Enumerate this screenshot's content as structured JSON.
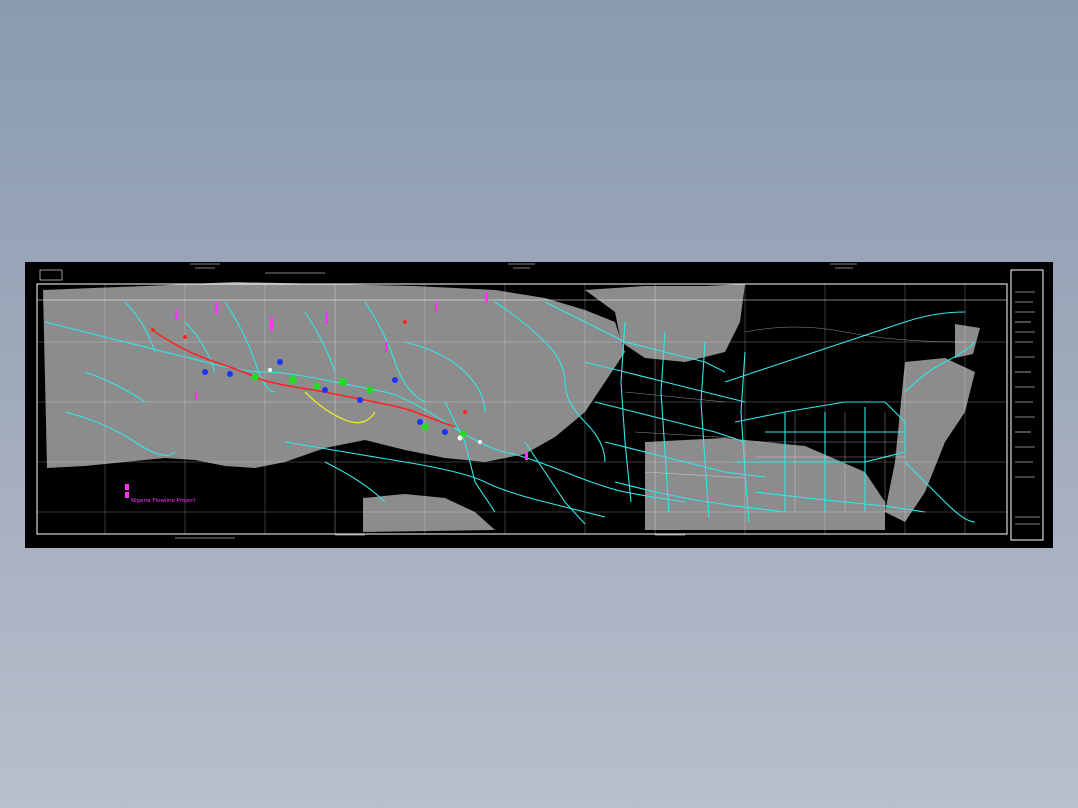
{
  "viewer": {
    "background_top": "#8a9aaf",
    "background_bottom": "#b9bfcc"
  },
  "drawing": {
    "background": "#000000",
    "colors": {
      "terrain": "#8c8c8c",
      "water_lines": "#33e6e6",
      "frame": "#ffffff",
      "markers_magenta": "#ff33ff",
      "markers_red": "#ff2222",
      "markers_blue": "#1a33ff",
      "markers_green": "#22dd22",
      "route_yellow": "#e6e633"
    },
    "legend": {
      "label": "Nigeria Flowline Project"
    }
  }
}
